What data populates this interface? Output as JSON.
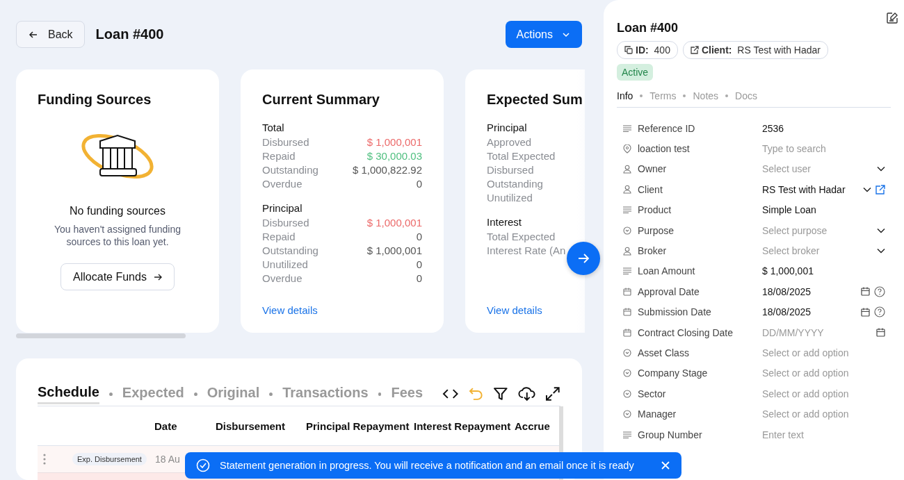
{
  "header": {
    "back": "Back",
    "title": "Loan #400",
    "actions": "Actions"
  },
  "funding": {
    "title": "Funding Sources",
    "empty_title": "No funding sources",
    "empty_text": "You haven't assigned funding sources to this loan yet.",
    "button": "Allocate Funds"
  },
  "summaries": [
    {
      "title": "Current Summary",
      "link": "View details",
      "sections": [
        {
          "heading": "Total",
          "rows": [
            {
              "label": "Disbursed",
              "value": "$ 1,000,001",
              "color": "#ec6a6a"
            },
            {
              "label": "Repaid",
              "value": "$ 30,000.03",
              "color": "#4fbf7f"
            },
            {
              "label": "Outstanding",
              "value": "$ 1,000,822.92",
              "color": "#555555"
            },
            {
              "label": "Overdue",
              "value": "0",
              "color": "#555555"
            }
          ]
        },
        {
          "heading": "Principal",
          "rows": [
            {
              "label": "Disbursed",
              "value": "$ 1,000,001",
              "color": "#ec6a6a"
            },
            {
              "label": "Repaid",
              "value": "0",
              "color": "#555555"
            },
            {
              "label": "Outstanding",
              "value": "$ 1,000,001",
              "color": "#555555"
            },
            {
              "label": "Unutilized",
              "value": "0",
              "color": "#555555"
            },
            {
              "label": "Overdue",
              "value": "0",
              "color": "#555555"
            }
          ]
        }
      ]
    },
    {
      "title": "Expected Sum",
      "link": "View details",
      "sections": [
        {
          "heading": "Principal",
          "rows": [
            {
              "label": "Approved"
            },
            {
              "label": "Total Expected"
            },
            {
              "label": "Disbursed"
            },
            {
              "label": "Outstanding"
            },
            {
              "label": "Unutilized"
            }
          ]
        },
        {
          "heading": "Interest",
          "rows": [
            {
              "label": "Total Expected"
            },
            {
              "label": "Interest Rate (An"
            }
          ]
        }
      ]
    }
  ],
  "schedule": {
    "tabs": [
      {
        "label": "Schedule",
        "selected": true
      },
      {
        "label": "Expected",
        "selected": false
      },
      {
        "label": "Original",
        "selected": false
      },
      {
        "label": "Transactions",
        "selected": false
      },
      {
        "label": "Fees",
        "selected": false
      }
    ],
    "columns": [
      "Date",
      "Disbursement",
      "Principal Repayment",
      "Interest Repayment",
      "Accrue"
    ],
    "rows": [
      {
        "tag": "Exp. Disbursement",
        "date": "18 Au"
      }
    ]
  },
  "toast": {
    "text": "Statement generation in progress. You will receive a notification and an email once it is ready"
  },
  "panel": {
    "title": "Loan #400",
    "chips": [
      {
        "kind": "copy",
        "label": "ID:",
        "value": "400"
      },
      {
        "kind": "link",
        "label": "Client:",
        "value": "RS Test with Hadar"
      }
    ],
    "status": "Active",
    "tabs": [
      {
        "label": "Info",
        "selected": true
      },
      {
        "label": "Terms",
        "selected": false
      },
      {
        "label": "Notes",
        "selected": false
      },
      {
        "label": "Docs",
        "selected": false
      }
    ],
    "fields": [
      {
        "kind": "text",
        "label": "Reference ID",
        "value": "2536"
      },
      {
        "kind": "location",
        "label": "loaction test",
        "placeholder": "Type to search"
      },
      {
        "kind": "user",
        "label": "Owner",
        "placeholder": "Select user",
        "dropdown": true
      },
      {
        "kind": "user",
        "label": "Client",
        "value": "RS Test with Hadar",
        "dropdown": true,
        "link": true
      },
      {
        "kind": "text",
        "label": "Product",
        "value": "Simple Loan"
      },
      {
        "kind": "select",
        "label": "Purpose",
        "placeholder": "Select purpose",
        "dropdown": true
      },
      {
        "kind": "user",
        "label": "Broker",
        "placeholder": "Select broker",
        "dropdown": true
      },
      {
        "kind": "text",
        "label": "Loan Amount",
        "value": "$ 1,000,001"
      },
      {
        "kind": "date",
        "label": "Approval Date",
        "value": "18/08/2025",
        "help": true
      },
      {
        "kind": "date",
        "label": "Submission Date",
        "value": "18/08/2025",
        "help": true
      },
      {
        "kind": "date",
        "label": "Contract Closing Date",
        "placeholder": "DD/MM/YYYY"
      },
      {
        "kind": "select",
        "label": "Asset Class",
        "placeholder": "Select or add option"
      },
      {
        "kind": "select",
        "label": "Company Stage",
        "placeholder": "Select or add option"
      },
      {
        "kind": "select",
        "label": "Sector",
        "placeholder": "Select or add option"
      },
      {
        "kind": "select",
        "label": "Manager",
        "placeholder": "Select or add option"
      },
      {
        "kind": "text",
        "label": "Group Number",
        "placeholder": "Enter text"
      }
    ]
  }
}
